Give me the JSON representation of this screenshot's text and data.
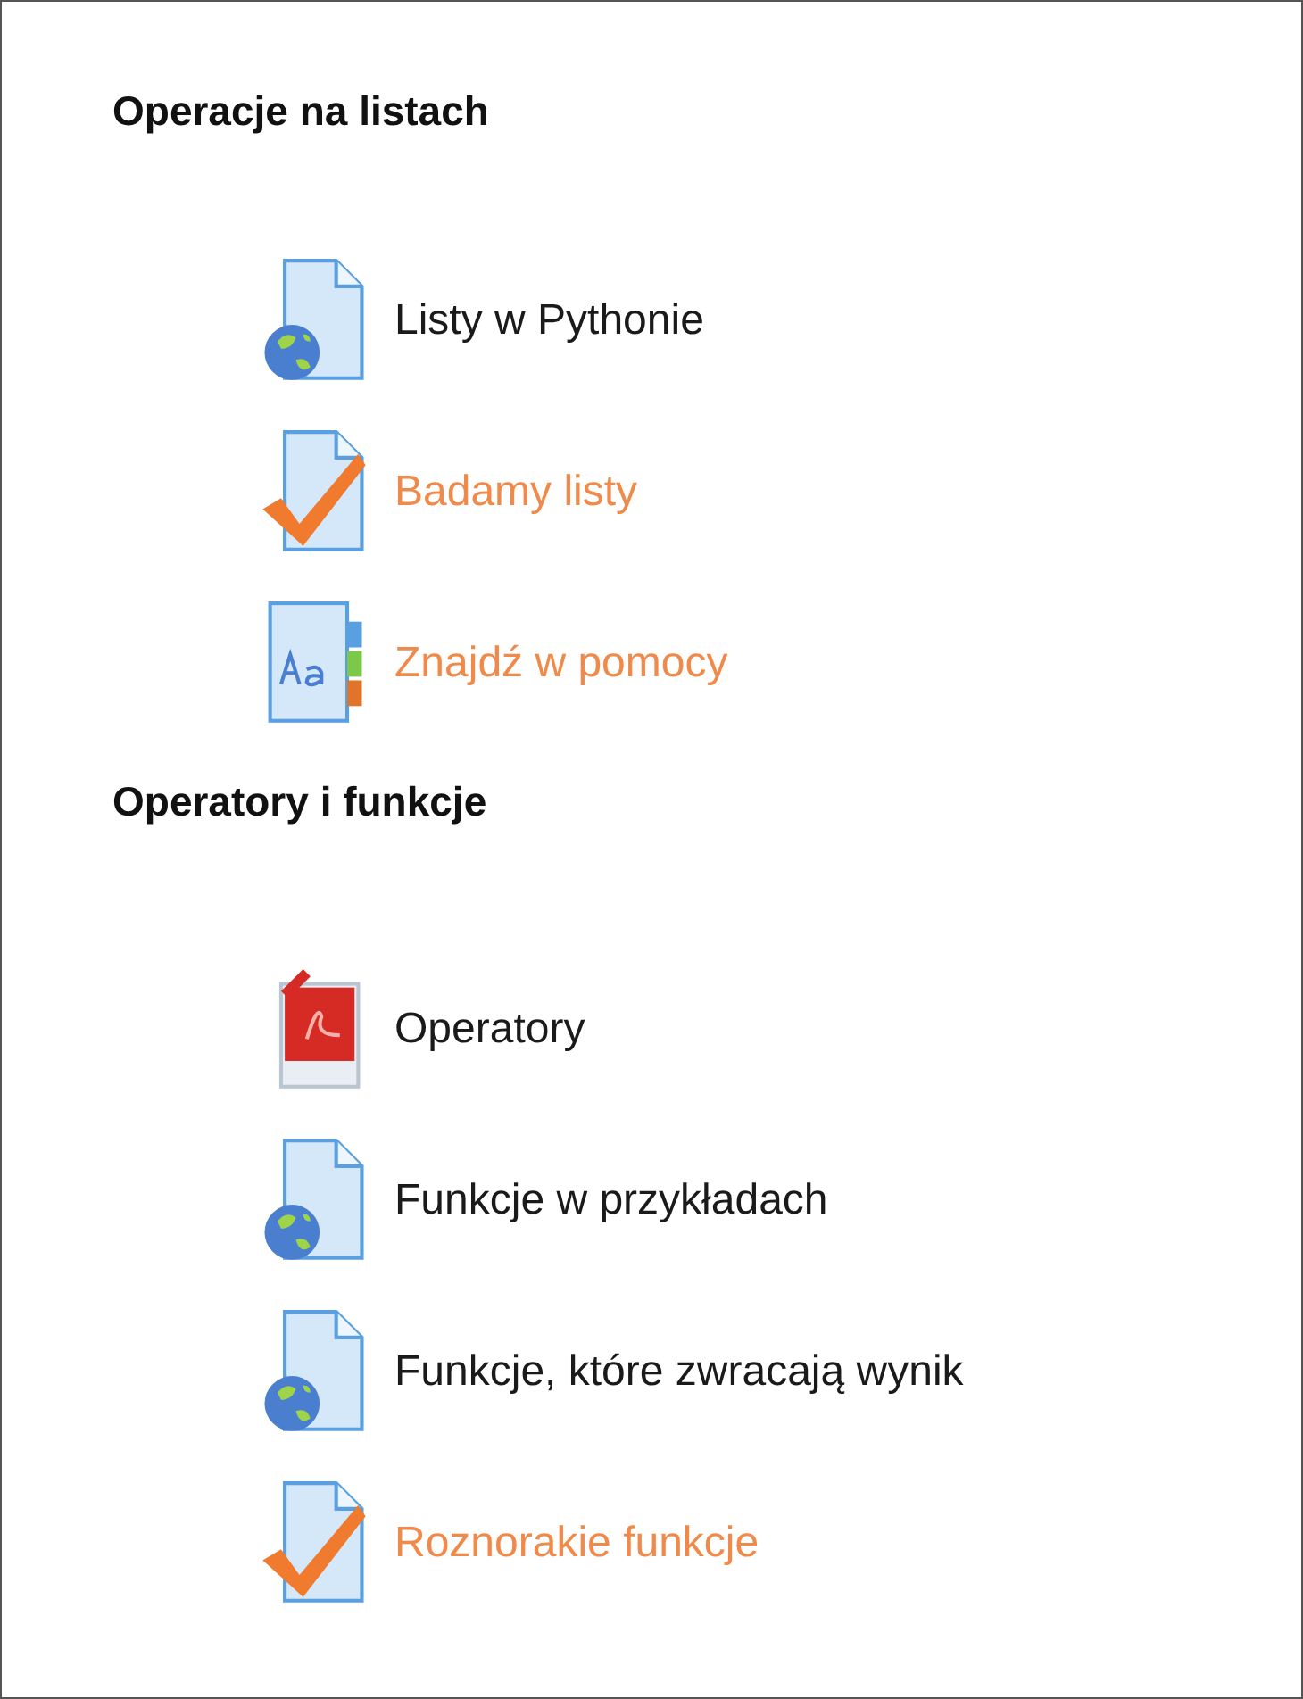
{
  "sections": [
    {
      "title": "Operacje na listach",
      "items": [
        {
          "label": "Listy w Pythonie",
          "kind": "page",
          "highlighted": false
        },
        {
          "label": "Badamy listy",
          "kind": "quiz",
          "highlighted": true
        },
        {
          "label": "Znajdź w pomocy",
          "kind": "glossary",
          "highlighted": true
        }
      ]
    },
    {
      "title": "Operatory i funkcje",
      "items": [
        {
          "label": "Operatory",
          "kind": "pdf",
          "highlighted": false
        },
        {
          "label": "Funkcje w przykładach",
          "kind": "page",
          "highlighted": false
        },
        {
          "label": "Funkcje, które zwracają wynik",
          "kind": "page",
          "highlighted": false
        },
        {
          "label": "Roznorakie funkcje",
          "kind": "quiz",
          "highlighted": true
        }
      ]
    }
  ]
}
